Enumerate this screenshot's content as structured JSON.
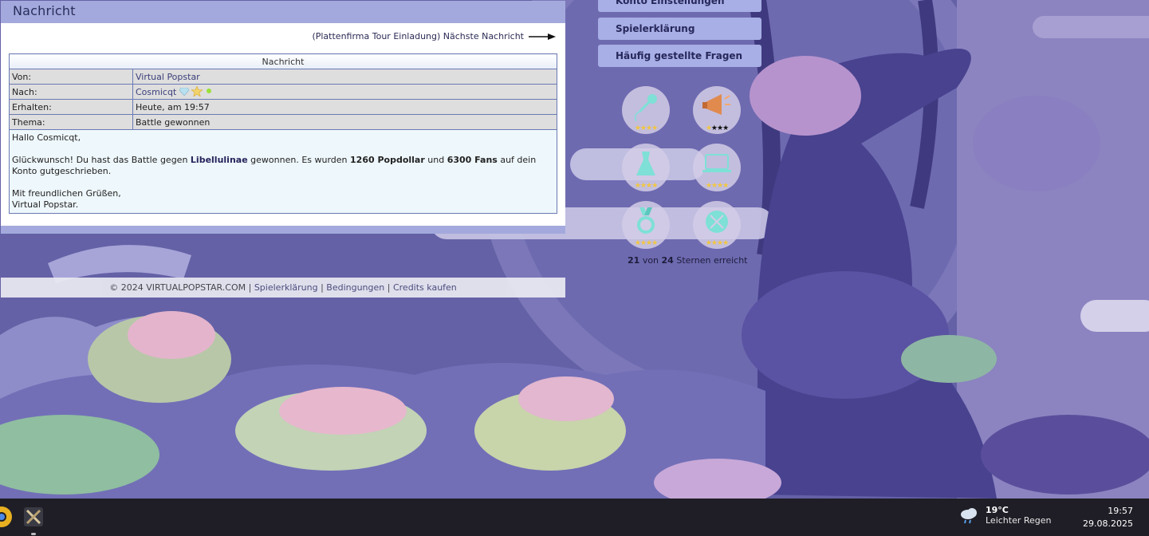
{
  "panel": {
    "title": "Nachricht",
    "next_message_link": "(Plattenfirma Tour Einladung) Nächste Nachricht",
    "table_header": "Nachricht",
    "rows": [
      {
        "label": "Von:",
        "value": "Virtual Popstar"
      },
      {
        "label": "Nach:",
        "value": "Cosmicqt"
      },
      {
        "label": "Erhalten:",
        "value": "Heute, am 19:57"
      },
      {
        "label": "Thema:",
        "value": "Battle gewonnen"
      }
    ],
    "body": {
      "greeting": "Hallo Cosmicqt,",
      "p1_a": "Glückwunsch! Du hast das Battle gegen ",
      "opponent": "Libellulinae",
      "p1_b": " gewonnen. Es wurden ",
      "popdollar": "1260 Popdollar",
      "p1_c": " und ",
      "fans": "6300 Fans",
      "p1_d": " auf dein Konto gutgeschrieben.",
      "closing1": "Mit freundlichen Grüßen,",
      "closing2": "Virtual Popstar."
    }
  },
  "footer": {
    "copyright": "© 2024 VIRTUALPOPSTAR.COM",
    "sep": " | ",
    "links": [
      "Spielerklärung",
      "Bedingungen",
      "Credits kaufen"
    ]
  },
  "menu": [
    "Konto Einstellungen",
    "Spielerklärung",
    "Häufig gestellte Fragen"
  ],
  "badges": [
    {
      "icon": "microphone-icon",
      "stars": 4,
      "max": 4
    },
    {
      "icon": "megaphone-icon",
      "stars": 1,
      "max": 4
    },
    {
      "icon": "dress-icon",
      "stars": 4,
      "max": 4
    },
    {
      "icon": "laptop-icon",
      "stars": 4,
      "max": 4
    },
    {
      "icon": "medal-icon",
      "stars": 4,
      "max": 4
    },
    {
      "icon": "compass-icon",
      "stars": 4,
      "max": 4
    }
  ],
  "progress": {
    "achieved": "21",
    "word_of": "von",
    "total": "24",
    "suffix": "Sternen erreicht"
  },
  "taskbar": {
    "weather_temp": "19°C",
    "weather_desc": "Leichter Regen",
    "time": "19:57",
    "date": "29.08.2025"
  },
  "colors": {
    "accent": "#a3a9dc",
    "panel_body": "#eef7fb",
    "row_bg": "#dedede",
    "taskbar": "#1f1e26"
  }
}
